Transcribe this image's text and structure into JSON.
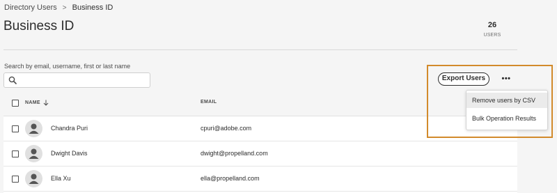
{
  "breadcrumb": {
    "parent": "Directory Users",
    "separator": ">",
    "current": "Business ID"
  },
  "page_title": "Business ID",
  "user_count": {
    "value": "26",
    "label": "USERS"
  },
  "search": {
    "label": "Search by email, username, first or last name",
    "placeholder": "",
    "value": ""
  },
  "table": {
    "columns": {
      "name": "NAME",
      "email": "EMAIL"
    },
    "sort_icon": "arrow-down-icon",
    "rows": [
      {
        "name": "Chandra Puri",
        "email": "cpuri@adobe.com"
      },
      {
        "name": "Dwight Davis",
        "email": "dwight@propelland.com"
      },
      {
        "name": "Ella Xu",
        "email": "ella@propelland.com"
      }
    ]
  },
  "actions": {
    "export_label": "Export Users",
    "more_label": "•••",
    "menu_items": [
      "Remove users by CSV",
      "Bulk Operation Results"
    ]
  },
  "colors": {
    "highlight": "#d28a2b",
    "background": "#f5f5f5"
  }
}
